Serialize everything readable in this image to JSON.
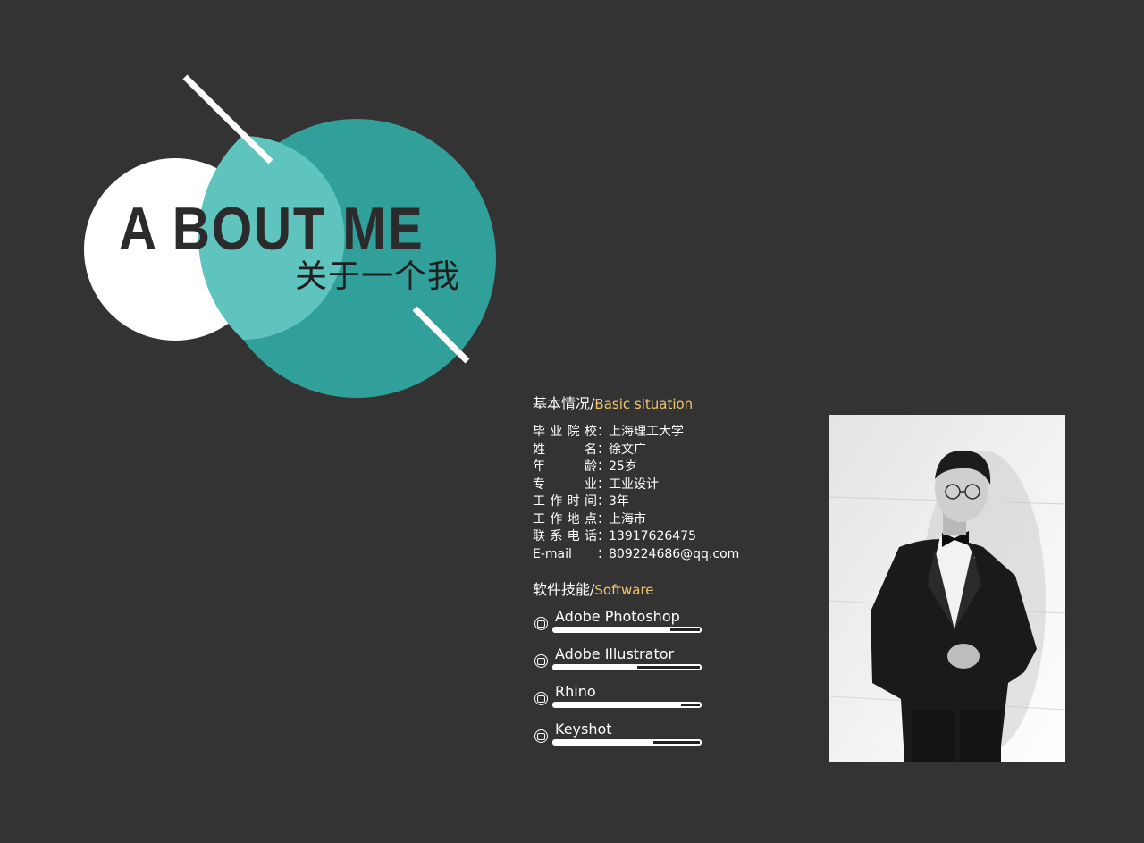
{
  "header": {
    "title_en": "A BOUT ME",
    "title_cn": "关于一个我"
  },
  "basic": {
    "heading_cn": "基本情况/",
    "heading_en": "Basic situation",
    "rows": [
      {
        "label": "毕业院校",
        "value": "上海理工大学"
      },
      {
        "label": "姓名",
        "value": "徐文广"
      },
      {
        "label": "年龄",
        "value": "25岁"
      },
      {
        "label": "专业",
        "value": "工业设计"
      },
      {
        "label": "工作时间",
        "value": "3年"
      },
      {
        "label": "工作地点",
        "value": "上海市"
      },
      {
        "label": "联系电话",
        "value": "13917626475"
      },
      {
        "label": "E-mail",
        "value": "809224686@qq.com"
      }
    ],
    "colon": "："
  },
  "software": {
    "heading_cn": "软件技能/",
    "heading_en": "Software",
    "skills": [
      {
        "name": "Adobe Photoshop",
        "level": 0.8,
        "icon": "photoshop-icon"
      },
      {
        "name": "Adobe Illustrator",
        "level": 0.57,
        "icon": "illustrator-icon"
      },
      {
        "name": "Rhino",
        "level": 0.87,
        "icon": "rhino-icon"
      },
      {
        "name": "Keyshot",
        "level": 0.68,
        "icon": "keyshot-icon"
      }
    ]
  },
  "colors": {
    "background": "#333333",
    "teal": "#31a09a",
    "overlap": "#5fc4be",
    "accent": "#f2c66d"
  }
}
